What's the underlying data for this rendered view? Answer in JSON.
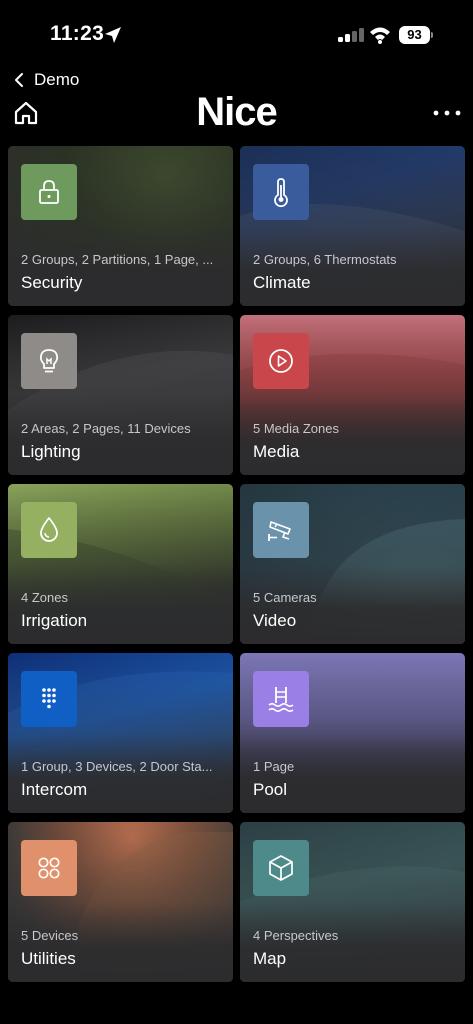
{
  "status": {
    "time": "11:23",
    "battery": "93"
  },
  "header": {
    "back_label": "Demo",
    "title": "Nice"
  },
  "tiles": [
    {
      "title": "Security",
      "subtitle": "2 Groups, 2 Partitions, 1 Page, ...",
      "icon": "lock-icon",
      "icon_color": "#6f9a5d"
    },
    {
      "title": "Climate",
      "subtitle": "2 Groups, 6 Thermostats",
      "icon": "thermometer-icon",
      "icon_color": "#3a5c9c"
    },
    {
      "title": "Lighting",
      "subtitle": "2 Areas, 2 Pages, 11 Devices",
      "icon": "lightbulb-icon",
      "icon_color": "#8e8b88"
    },
    {
      "title": "Media",
      "subtitle": "5 Media Zones",
      "icon": "play-icon",
      "icon_color": "#c9474a"
    },
    {
      "title": "Irrigation",
      "subtitle": "4 Zones",
      "icon": "water-drop-icon",
      "icon_color": "#95b061"
    },
    {
      "title": "Video",
      "subtitle": "5 Cameras",
      "icon": "camera-icon",
      "icon_color": "#6a93ab"
    },
    {
      "title": "Intercom",
      "subtitle": "1 Group, 3 Devices, 2 Door Sta...",
      "icon": "keypad-icon",
      "icon_color": "#0f5fc4"
    },
    {
      "title": "Pool",
      "subtitle": "1 Page",
      "icon": "pool-icon",
      "icon_color": "#9a7fe6"
    },
    {
      "title": "Utilities",
      "subtitle": "5 Devices",
      "icon": "utilities-icon",
      "icon_color": "#e0906a"
    },
    {
      "title": "Map",
      "subtitle": "4 Perspectives",
      "icon": "cube-icon",
      "icon_color": "#4e8a8a"
    }
  ]
}
